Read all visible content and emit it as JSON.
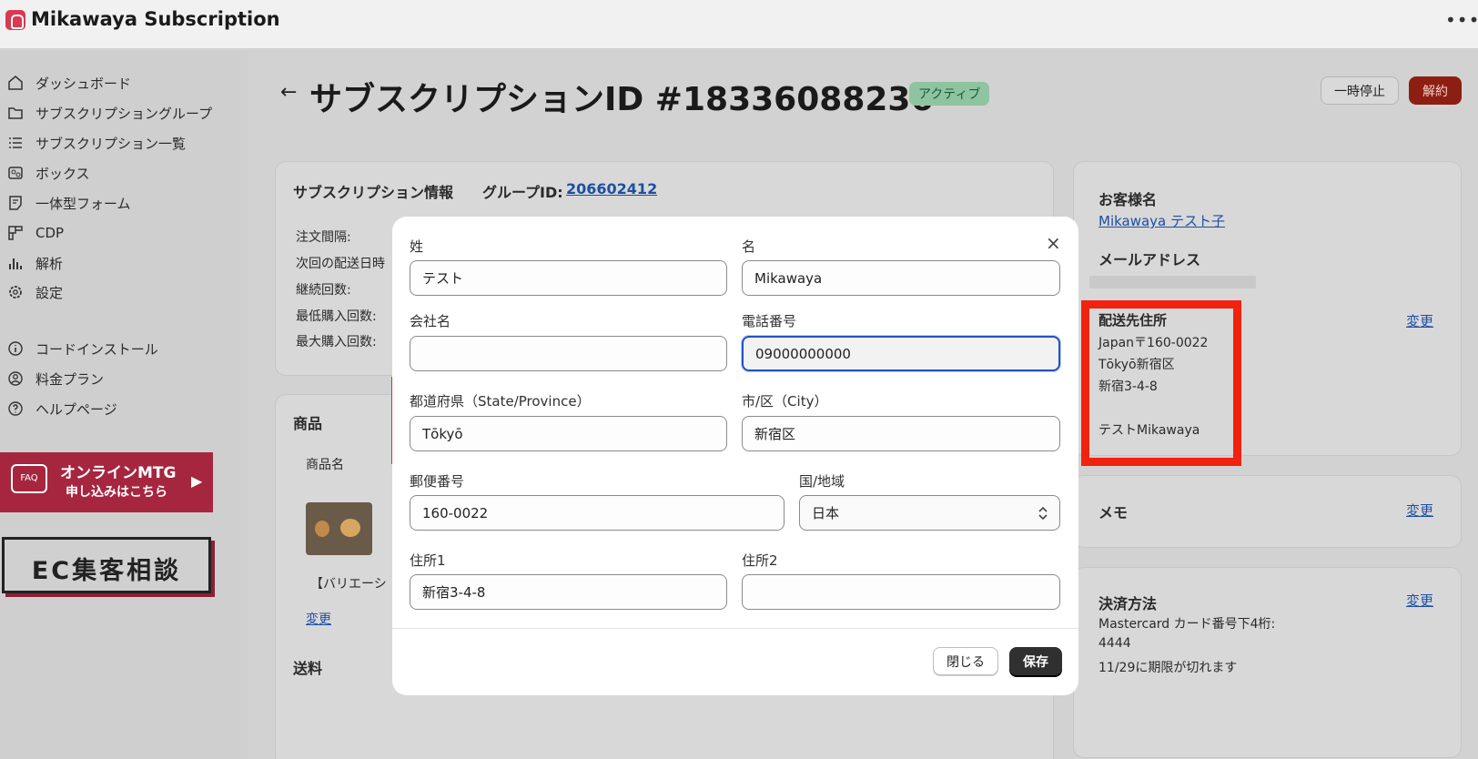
{
  "app": {
    "title": "Mikawaya Subscription",
    "more_icon": "more-horizontal-icon"
  },
  "sidebar": {
    "items": [
      {
        "label": "ダッシュボード",
        "icon": "home-icon"
      },
      {
        "label": "サブスクリプショングループ",
        "icon": "folder-icon"
      },
      {
        "label": "サブスクリプション一覧",
        "icon": "list-icon"
      },
      {
        "label": "ボックス",
        "icon": "box-icon"
      },
      {
        "label": "一体型フォーム",
        "icon": "form-icon"
      },
      {
        "label": "CDP",
        "icon": "grid-icon"
      },
      {
        "label": "解析",
        "icon": "chart-icon"
      },
      {
        "label": "設定",
        "icon": "gear-icon"
      }
    ],
    "secondary_items": [
      {
        "label": "コードインストール",
        "icon": "info-icon"
      },
      {
        "label": "料金プラン",
        "icon": "user-circle-icon"
      },
      {
        "label": "ヘルプページ",
        "icon": "help-icon"
      }
    ],
    "banner_mtg": {
      "faq": "FAQ",
      "line1": "オンラインMTG",
      "line2": "申し込みはこちら",
      "arrow": "▶"
    },
    "banner_ec": {
      "text": "EC集客相談"
    }
  },
  "header": {
    "back_icon": "←",
    "title": "サブスクリプションID #18336088236",
    "status": "アクティブ",
    "pause_label": "一時停止",
    "cancel_label": "解約"
  },
  "subscription_card": {
    "title": "サブスクリプション情報",
    "group_label": "グループID:",
    "group_id": "206602412",
    "rows": [
      "注文間隔:",
      "次回の配送日時",
      "継続回数:",
      "最低購入回数:",
      "最大購入回数:"
    ]
  },
  "product_card": {
    "title": "商品",
    "col_name": "商品名",
    "item_name": "【バリエーシ",
    "change_link": "変更",
    "shipping_label": "送料"
  },
  "customer_card": {
    "name_label": "お客様名",
    "name": "Mikawaya テスト子",
    "email_label": "メールアドレス",
    "address_label": "配送先住所",
    "address_lines": [
      "Japan〒160-0022",
      "Tōkyō新宿区",
      "新宿3-4-8",
      "",
      "テストMikawaya"
    ],
    "change_link": "変更"
  },
  "memo_card": {
    "title": "メモ",
    "change_link": "変更"
  },
  "payment_card": {
    "title": "決済方法",
    "line1": "Mastercard  カード番号下4桁:",
    "line2": "4444",
    "line3": "11/29に期限が切れます",
    "change_link": "変更"
  },
  "modal": {
    "close_icon": "×",
    "last_name_label": "姓",
    "last_name_value": "テスト",
    "first_name_label": "名",
    "first_name_value": "Mikawaya",
    "company_label": "会社名",
    "company_value": "",
    "phone_label": "電話番号",
    "phone_value": "09000000000",
    "state_label": "都道府県（State/Province）",
    "state_value": "Tōkyō",
    "city_label": "市/区（City）",
    "city_value": "新宿区",
    "zip_label": "郵便番号",
    "zip_value": "160-0022",
    "country_label": "国/地域",
    "country_value": "日本",
    "address1_label": "住所1",
    "address1_value": "新宿3-4-8",
    "address2_label": "住所2",
    "address2_value": "",
    "close_label": "閉じる",
    "save_label": "保存"
  },
  "colors": {
    "highlight": "#f0230f",
    "primary_button": "#303030",
    "focus_ring": "#2153c7",
    "cancel_button": "#d0301c",
    "badge": "#aee9c1"
  }
}
